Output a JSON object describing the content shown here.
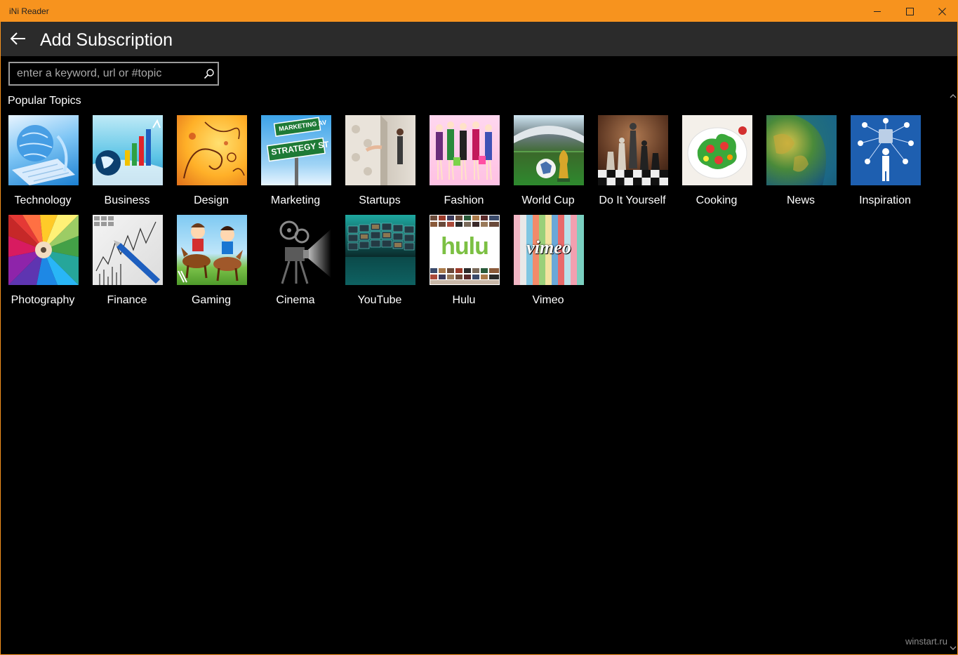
{
  "window": {
    "title": "iNi Reader"
  },
  "appbar": {
    "title": "Add Subscription"
  },
  "search": {
    "placeholder": "enter a keyword, url or #topic"
  },
  "section": {
    "title": "Popular Topics"
  },
  "topics": [
    {
      "label": "Technology"
    },
    {
      "label": "Business"
    },
    {
      "label": "Design"
    },
    {
      "label": "Marketing",
      "sign_top": "MARKETING AV",
      "sign_bottom": "STRATEGY ST"
    },
    {
      "label": "Startups"
    },
    {
      "label": "Fashion"
    },
    {
      "label": "World Cup"
    },
    {
      "label": "Do It Yourself"
    },
    {
      "label": "Cooking"
    },
    {
      "label": "News"
    },
    {
      "label": "Inspiration"
    },
    {
      "label": "Photography"
    },
    {
      "label": "Finance"
    },
    {
      "label": "Gaming"
    },
    {
      "label": "Cinema"
    },
    {
      "label": "YouTube"
    },
    {
      "label": "Hulu",
      "logo": "hulu"
    },
    {
      "label": "Vimeo",
      "logo": "vimeo"
    }
  ],
  "watermark": "winstart.ru",
  "colors": {
    "titlebar": "#f7931e",
    "appbar": "#2b2b2b",
    "background": "#000000"
  }
}
